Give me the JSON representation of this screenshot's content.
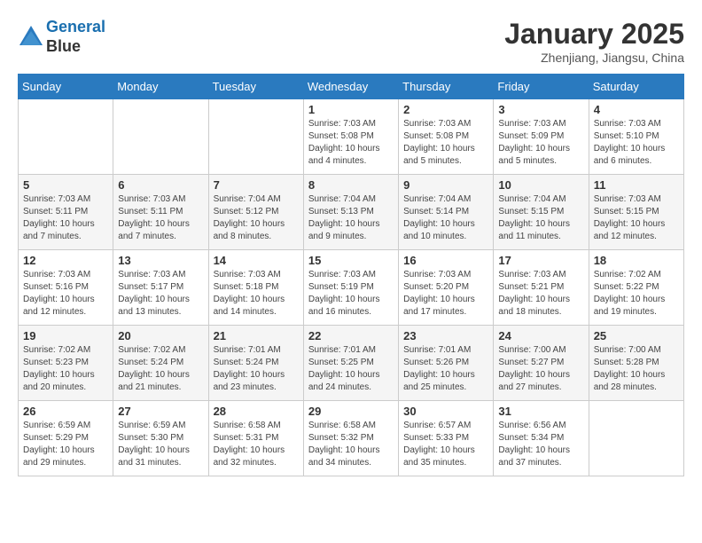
{
  "header": {
    "logo_line1": "General",
    "logo_line2": "Blue",
    "month_title": "January 2025",
    "subtitle": "Zhenjiang, Jiangsu, China"
  },
  "weekdays": [
    "Sunday",
    "Monday",
    "Tuesday",
    "Wednesday",
    "Thursday",
    "Friday",
    "Saturday"
  ],
  "weeks": [
    {
      "shade": false,
      "days": [
        {
          "num": "",
          "info": ""
        },
        {
          "num": "",
          "info": ""
        },
        {
          "num": "",
          "info": ""
        },
        {
          "num": "1",
          "info": "Sunrise: 7:03 AM\nSunset: 5:08 PM\nDaylight: 10 hours\nand 4 minutes."
        },
        {
          "num": "2",
          "info": "Sunrise: 7:03 AM\nSunset: 5:08 PM\nDaylight: 10 hours\nand 5 minutes."
        },
        {
          "num": "3",
          "info": "Sunrise: 7:03 AM\nSunset: 5:09 PM\nDaylight: 10 hours\nand 5 minutes."
        },
        {
          "num": "4",
          "info": "Sunrise: 7:03 AM\nSunset: 5:10 PM\nDaylight: 10 hours\nand 6 minutes."
        }
      ]
    },
    {
      "shade": true,
      "days": [
        {
          "num": "5",
          "info": "Sunrise: 7:03 AM\nSunset: 5:11 PM\nDaylight: 10 hours\nand 7 minutes."
        },
        {
          "num": "6",
          "info": "Sunrise: 7:03 AM\nSunset: 5:11 PM\nDaylight: 10 hours\nand 7 minutes."
        },
        {
          "num": "7",
          "info": "Sunrise: 7:04 AM\nSunset: 5:12 PM\nDaylight: 10 hours\nand 8 minutes."
        },
        {
          "num": "8",
          "info": "Sunrise: 7:04 AM\nSunset: 5:13 PM\nDaylight: 10 hours\nand 9 minutes."
        },
        {
          "num": "9",
          "info": "Sunrise: 7:04 AM\nSunset: 5:14 PM\nDaylight: 10 hours\nand 10 minutes."
        },
        {
          "num": "10",
          "info": "Sunrise: 7:04 AM\nSunset: 5:15 PM\nDaylight: 10 hours\nand 11 minutes."
        },
        {
          "num": "11",
          "info": "Sunrise: 7:03 AM\nSunset: 5:15 PM\nDaylight: 10 hours\nand 12 minutes."
        }
      ]
    },
    {
      "shade": false,
      "days": [
        {
          "num": "12",
          "info": "Sunrise: 7:03 AM\nSunset: 5:16 PM\nDaylight: 10 hours\nand 12 minutes."
        },
        {
          "num": "13",
          "info": "Sunrise: 7:03 AM\nSunset: 5:17 PM\nDaylight: 10 hours\nand 13 minutes."
        },
        {
          "num": "14",
          "info": "Sunrise: 7:03 AM\nSunset: 5:18 PM\nDaylight: 10 hours\nand 14 minutes."
        },
        {
          "num": "15",
          "info": "Sunrise: 7:03 AM\nSunset: 5:19 PM\nDaylight: 10 hours\nand 16 minutes."
        },
        {
          "num": "16",
          "info": "Sunrise: 7:03 AM\nSunset: 5:20 PM\nDaylight: 10 hours\nand 17 minutes."
        },
        {
          "num": "17",
          "info": "Sunrise: 7:03 AM\nSunset: 5:21 PM\nDaylight: 10 hours\nand 18 minutes."
        },
        {
          "num": "18",
          "info": "Sunrise: 7:02 AM\nSunset: 5:22 PM\nDaylight: 10 hours\nand 19 minutes."
        }
      ]
    },
    {
      "shade": true,
      "days": [
        {
          "num": "19",
          "info": "Sunrise: 7:02 AM\nSunset: 5:23 PM\nDaylight: 10 hours\nand 20 minutes."
        },
        {
          "num": "20",
          "info": "Sunrise: 7:02 AM\nSunset: 5:24 PM\nDaylight: 10 hours\nand 21 minutes."
        },
        {
          "num": "21",
          "info": "Sunrise: 7:01 AM\nSunset: 5:24 PM\nDaylight: 10 hours\nand 23 minutes."
        },
        {
          "num": "22",
          "info": "Sunrise: 7:01 AM\nSunset: 5:25 PM\nDaylight: 10 hours\nand 24 minutes."
        },
        {
          "num": "23",
          "info": "Sunrise: 7:01 AM\nSunset: 5:26 PM\nDaylight: 10 hours\nand 25 minutes."
        },
        {
          "num": "24",
          "info": "Sunrise: 7:00 AM\nSunset: 5:27 PM\nDaylight: 10 hours\nand 27 minutes."
        },
        {
          "num": "25",
          "info": "Sunrise: 7:00 AM\nSunset: 5:28 PM\nDaylight: 10 hours\nand 28 minutes."
        }
      ]
    },
    {
      "shade": false,
      "days": [
        {
          "num": "26",
          "info": "Sunrise: 6:59 AM\nSunset: 5:29 PM\nDaylight: 10 hours\nand 29 minutes."
        },
        {
          "num": "27",
          "info": "Sunrise: 6:59 AM\nSunset: 5:30 PM\nDaylight: 10 hours\nand 31 minutes."
        },
        {
          "num": "28",
          "info": "Sunrise: 6:58 AM\nSunset: 5:31 PM\nDaylight: 10 hours\nand 32 minutes."
        },
        {
          "num": "29",
          "info": "Sunrise: 6:58 AM\nSunset: 5:32 PM\nDaylight: 10 hours\nand 34 minutes."
        },
        {
          "num": "30",
          "info": "Sunrise: 6:57 AM\nSunset: 5:33 PM\nDaylight: 10 hours\nand 35 minutes."
        },
        {
          "num": "31",
          "info": "Sunrise: 6:56 AM\nSunset: 5:34 PM\nDaylight: 10 hours\nand 37 minutes."
        },
        {
          "num": "",
          "info": ""
        }
      ]
    }
  ]
}
